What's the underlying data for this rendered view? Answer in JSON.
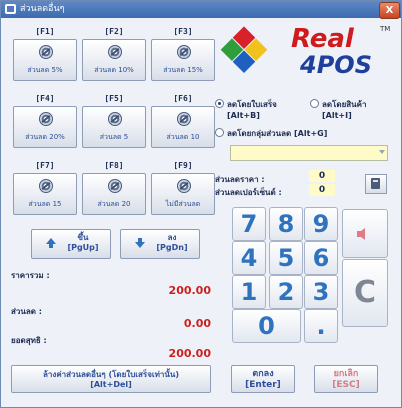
{
  "window": {
    "title": "ส่วนลดอื่นๆ",
    "close_label": "X"
  },
  "fkeys": [
    {
      "key": "[F1]",
      "label": "ส่วนลด 5%"
    },
    {
      "key": "[F2]",
      "label": "ส่วนลด 10%"
    },
    {
      "key": "[F3]",
      "label": "ส่วนลด 15%"
    },
    {
      "key": "[F4]",
      "label": "ส่วนลด 20%"
    },
    {
      "key": "[F5]",
      "label": "ส่วนลด 5"
    },
    {
      "key": "[F6]",
      "label": "ส่วนลด 10"
    },
    {
      "key": "[F7]",
      "label": "ส่วนลด 15"
    },
    {
      "key": "[F8]",
      "label": "ส่วนลด 20"
    },
    {
      "key": "[F9]",
      "label": "ไม่มีส่วนลด"
    }
  ],
  "paging": {
    "up_label": "ขึ้น",
    "up_key": "[PgUp]",
    "down_label": "ลง",
    "down_key": "[PgDn]"
  },
  "summary": {
    "total_label": "ราคารวม :",
    "total_value": "200.00",
    "discount_label": "ส่วนลด :",
    "discount_value": "0.00",
    "net_label": "ยอดสุทธิ :",
    "net_value": "200.00"
  },
  "clear_discount": {
    "label": "ล้างค่าส่วนลดอื่นๆ (โดยใบเสร็จเท่านั้น)",
    "key": "[Alt+Del]"
  },
  "logo": {
    "word1": "Real",
    "word2": "4POS",
    "tm": "TM"
  },
  "discount_mode": {
    "by_receipt_label": "ลดโดยใบเสร็จ",
    "by_receipt_key": "[Alt+B]",
    "by_item_label": "ลดโดยสินค้า",
    "by_item_key": "[Alt+I]",
    "by_group_label": "ลดโดยกลุ่มส่วนลด [Alt+G]",
    "selected": "by_receipt"
  },
  "inputs": {
    "price_discount_label": "ส่วนลดราคา :",
    "price_discount_value": "0",
    "percent_discount_label": "ส่วนลดเปอร์เซ็นต์ :",
    "percent_discount_value": "0"
  },
  "numpad": {
    "keys": [
      "7",
      "8",
      "9",
      "4",
      "5",
      "6",
      "1",
      "2",
      "3"
    ],
    "zero": "0",
    "dot": ".",
    "clear": "C",
    "key_color": "#2f73bf"
  },
  "actions": {
    "ok_label": "ตกลง",
    "ok_key": "[Enter]",
    "cancel_label": "ยกเลิก",
    "cancel_key": "[ESC]"
  },
  "colors": {
    "accent": "#2f4f9a",
    "value_red": "#cc1f1f",
    "logo_red": "#cf1b1b",
    "logo_blue": "#1f3f9c",
    "input_bg": "#fffbc9"
  }
}
